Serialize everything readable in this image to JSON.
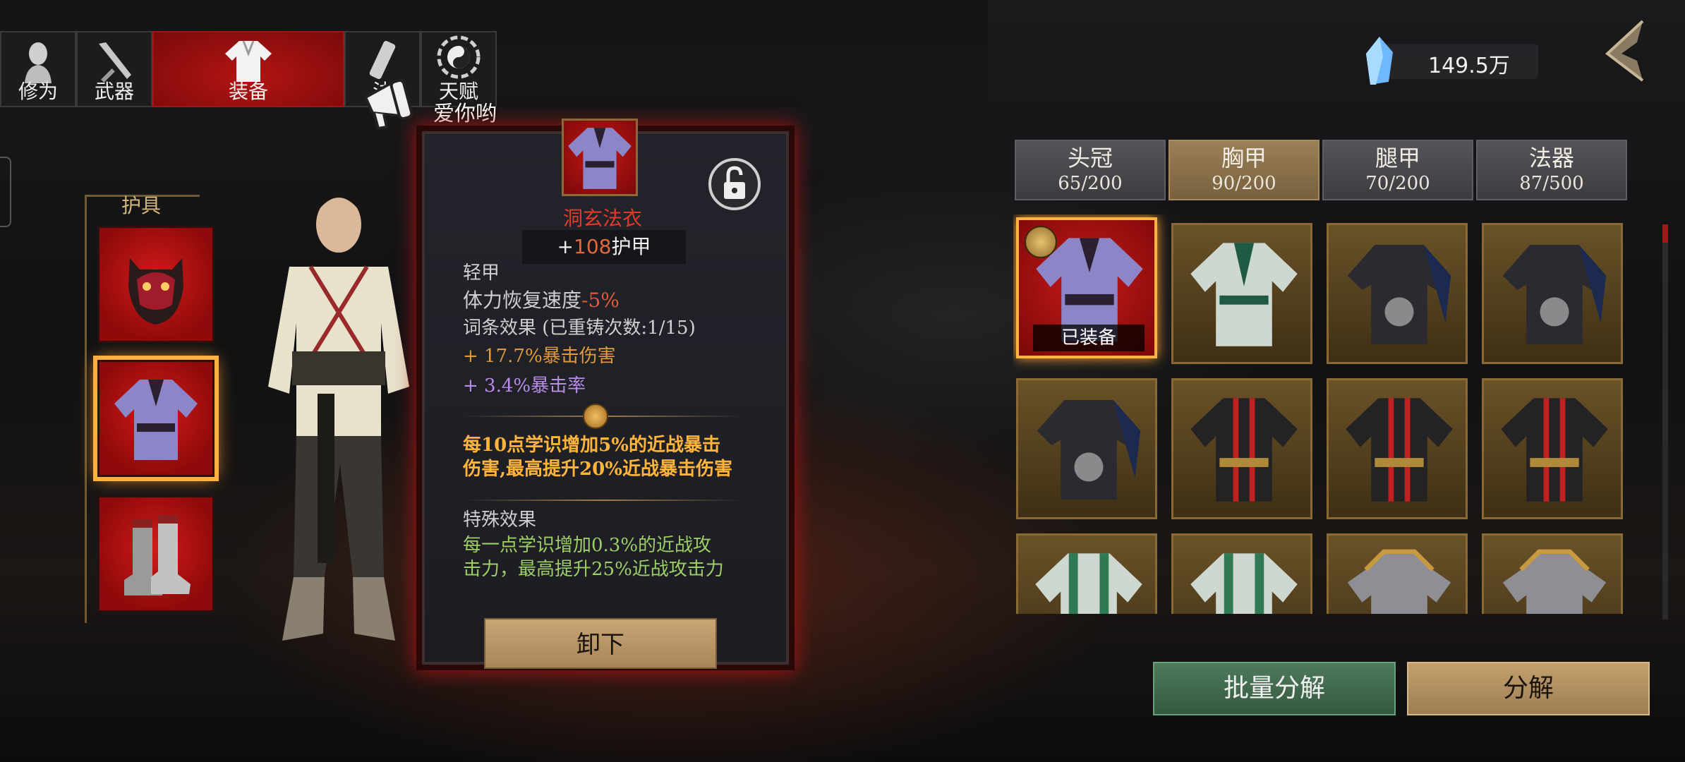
{
  "tabs": [
    {
      "label": "修为",
      "icon": "cultivation-icon",
      "active": false
    },
    {
      "label": "武器",
      "icon": "weapon-icon",
      "active": false
    },
    {
      "label": "装备",
      "icon": "robe-icon",
      "active": true
    },
    {
      "label": "法",
      "icon": "magic-tool-icon",
      "active": false
    },
    {
      "label": "天赋",
      "icon": "bagua-icon",
      "active": false
    }
  ],
  "watermark": {
    "text": "爱你哟"
  },
  "currency": {
    "value": "149.5万",
    "icon": "crystal-icon"
  },
  "slots": {
    "title": "护具",
    "items": [
      {
        "name": "demon-mask",
        "selected": false
      },
      {
        "name": "purple-robe",
        "selected": true
      },
      {
        "name": "armored-boots",
        "selected": false
      }
    ]
  },
  "detail": {
    "name": "洞玄法衣",
    "armor_prefix": "+",
    "armor_value": "108",
    "armor_label": "护甲",
    "type": "轻甲",
    "stat_label": "体力恢复速度",
    "stat_value": "-5%",
    "affix_title": "词条效果",
    "affix_note": "(已重铸次数:1/15)",
    "affix_1": "+ 17.7%暴击伤害",
    "affix_2": "+ 3.4%暴击率",
    "set_line_1": "每10点学识增加5%的近战暴击",
    "set_line_2": "伤害,最高提升20%近战暴击伤害",
    "special_title": "特殊效果",
    "special_line_1": "每一点学识增加0.3%的近战攻",
    "special_line_2": "击力，最高提升25%近战攻击力",
    "unequip_label": "卸下"
  },
  "categories": [
    {
      "name": "头冠",
      "count": "65/200",
      "active": false
    },
    {
      "name": "胸甲",
      "count": "90/200",
      "active": true
    },
    {
      "name": "腿甲",
      "count": "70/200",
      "active": false
    },
    {
      "name": "法器",
      "count": "87/500",
      "active": false
    }
  ],
  "inventory": {
    "equipped_label": "已装备",
    "items": [
      {
        "name": "purple-robe",
        "equipped": true
      },
      {
        "name": "green-robe",
        "equipped": false
      },
      {
        "name": "black-skull-armor",
        "equipped": false
      },
      {
        "name": "black-skull-armor",
        "equipped": false
      },
      {
        "name": "black-skull-armor",
        "equipped": false
      },
      {
        "name": "black-red-robe",
        "equipped": false
      },
      {
        "name": "black-red-robe",
        "equipped": false
      },
      {
        "name": "black-red-robe",
        "equipped": false
      },
      {
        "name": "green-robe",
        "equipped": false
      },
      {
        "name": "green-robe",
        "equipped": false
      },
      {
        "name": "steel-armor",
        "equipped": false
      },
      {
        "name": "steel-armor",
        "equipped": false
      }
    ]
  },
  "actions": {
    "batch_label": "批量分解",
    "decompose_label": "分解"
  },
  "colors": {
    "accent_red": "#b31414",
    "gold": "#ffb340",
    "panel_bg": "#23232b"
  }
}
